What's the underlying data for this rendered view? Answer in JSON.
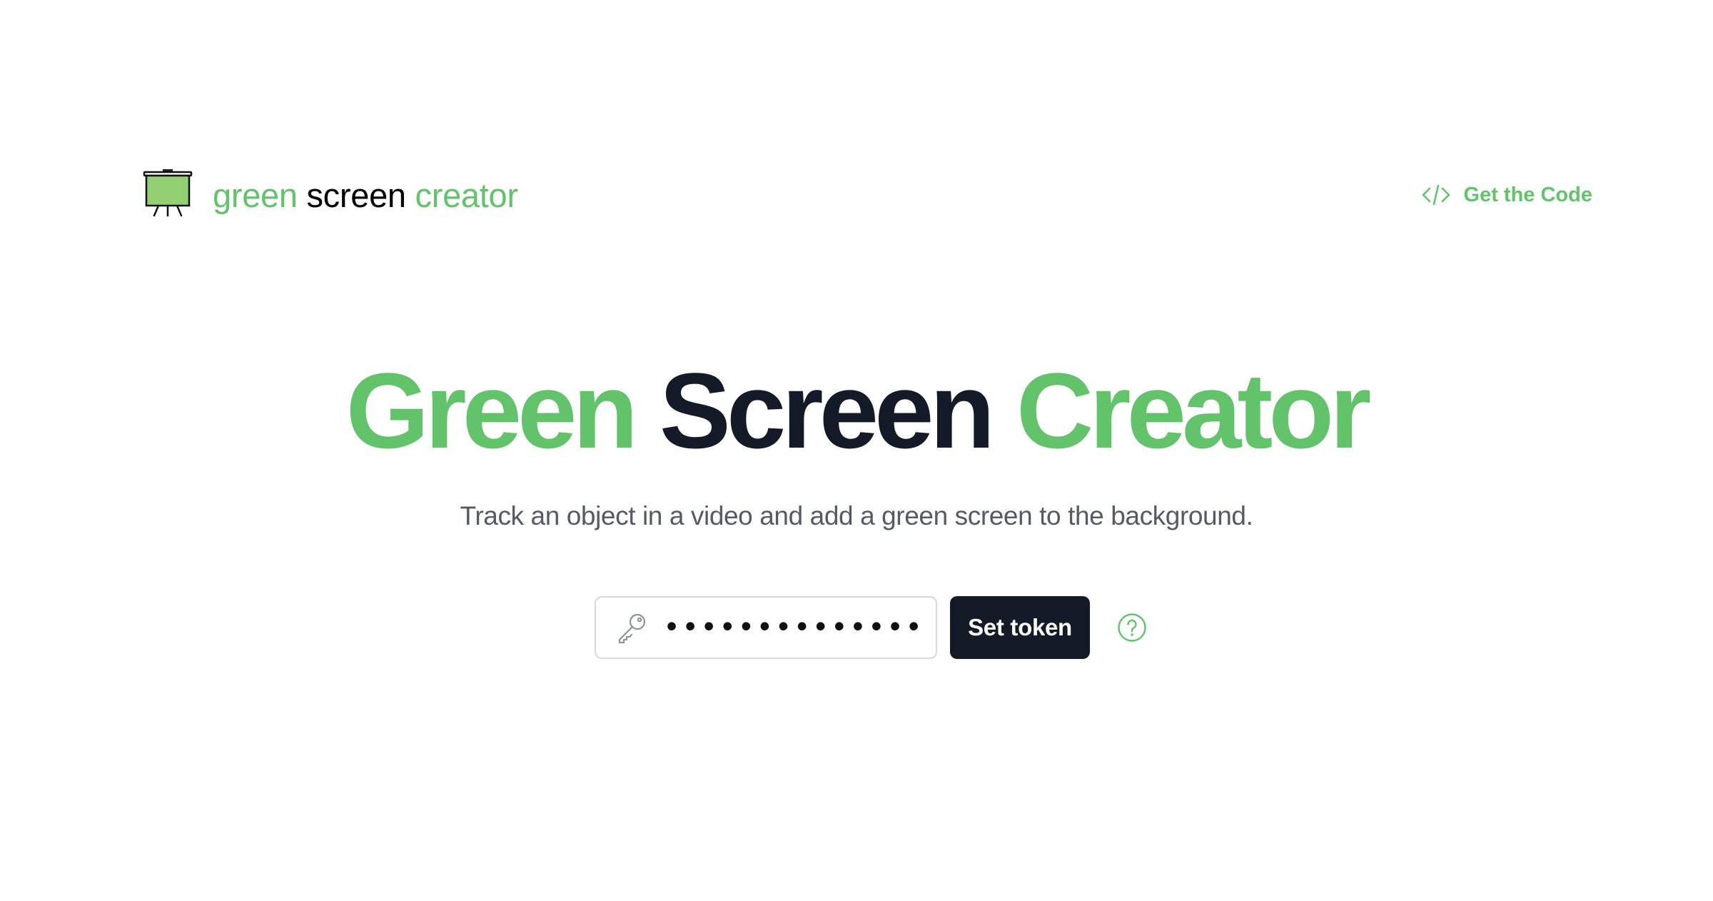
{
  "header": {
    "logo": {
      "icon": "easel-green-screen-icon",
      "word1": "green",
      "word2": "screen",
      "word3": "creator"
    },
    "get_code": {
      "icon": "code-brackets-icon",
      "label": "Get the Code"
    }
  },
  "hero": {
    "title_word1": "Green",
    "title_word2": "Screen",
    "title_word3": "Creator",
    "subtitle": "Track an object in a video and add a green screen to the background."
  },
  "token_form": {
    "icon": "key-icon",
    "value": "••••••••••••••••••••••••",
    "button_label": "Set token",
    "help_icon": "question-circle-icon"
  },
  "colors": {
    "accent_green": "#62c36b",
    "dark": "#141a27",
    "subtitle_gray": "#555b66",
    "border_gray": "#d7d9dd"
  }
}
